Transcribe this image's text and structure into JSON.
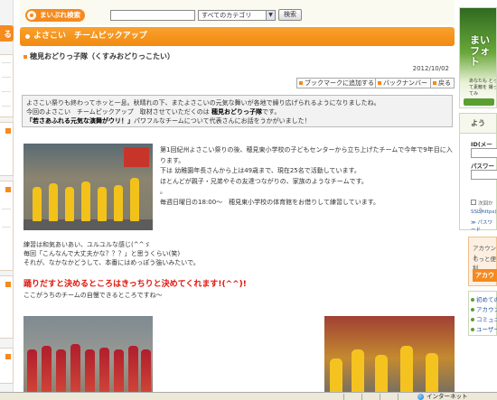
{
  "search": {
    "logo_text": "まいぷれ検索",
    "query_value": "",
    "category_selected": "すべてのカテゴリ",
    "button_label": "検索"
  },
  "header": {
    "title": "よさこい　チームピックアップ"
  },
  "article": {
    "title": "穂見おどりっ子隊（くすみおどりっこたい）",
    "date": "2012/10/02",
    "buttons": {
      "bookmark": "ブックマークに追加する",
      "back_number": "バックナンバー",
      "back": "戻る"
    },
    "intro": {
      "line1": "よさこい祭りも終わってホッと一息。秋晴れの下、またよさこいの元気な舞いが各地で繰り広げられるようになりましたね。",
      "line2_prefix": "今回のよさこい　チームピックアップ　取材させていただくのは ",
      "line2_team": "穂見おどりっ子隊",
      "line2_suffix": "です。",
      "line3_bold": "「若さあふれる元気な演舞がウリ！」",
      "line3_rest": "パワフルなチームについて代表さんにお話をうかがいました！"
    },
    "body": {
      "line1": "第1回紀州よさこい祭りの後、穂見東小学校の子どもセンターから立ち上げたチームで今年で9年目に入ります。",
      "line2": "下は 幼稚園年長さんから上は49歳まで、現在25名で活動しています。",
      "line3": "ほとんどが親子・兄弟やその友達つながりの、家族のようなチームです。",
      "line4": "。",
      "line5": "毎週日曜日の18:00～　穂見東小学校の体育館をお借りして練習しています。"
    },
    "para2": {
      "line1": "練習は和気あいあい、ユルユルな感じ(^^ゞ",
      "line2": "毎回「こんなんで大丈夫かな？？？」と思うくらい(笑)",
      "line3": "それが、なかなかどうして、本番にはめっぽう強いみたいで。"
    },
    "highlight": "踊りだすと決めるところはきっちりと決めてくれます!(^^)!",
    "para3": "ここがうちのチームの自慢できるところですね～"
  },
  "left": {
    "top_tab": "る"
  },
  "right": {
    "ad_title": "まい フォト",
    "ad_sub": "あなたも とって素敵を 撮ってみ",
    "login_head": "よう",
    "id_label": "ID(メール",
    "password_label": "パスワード",
    "remember_text": "次回から",
    "ssl_link": "SSL(https)",
    "forgot_link": "≫ パスワード",
    "acct_line1": "アカウント",
    "acct_line2": "もっと便利",
    "acct_button": "アカウ",
    "links": [
      "初めての",
      "アカウン",
      "コミュニ",
      "ユーザー"
    ]
  },
  "status": {
    "zone": "インターネット"
  },
  "colors": {
    "accent_orange": "#f58a1f",
    "highlight_red": "#e0140a",
    "link_blue": "#2b5aa8"
  }
}
